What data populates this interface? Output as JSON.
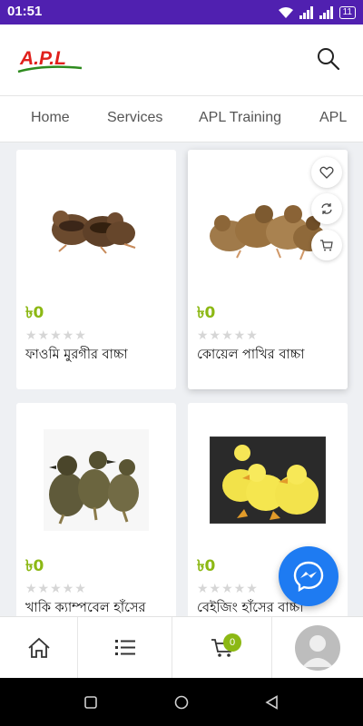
{
  "status_bar": {
    "time": "01:51",
    "battery": "11"
  },
  "header": {
    "logo_text": "A.P.L",
    "brand_color": "#e0201c",
    "accent_color": "#2e8b1e"
  },
  "nav_tabs": [
    "Home",
    "Services",
    "APL Training",
    "APL"
  ],
  "products": [
    {
      "price": "৳0",
      "rating": "★★★★★",
      "name": "ফাওমি মুরগীর বাচ্চা",
      "image": "quail-chicks"
    },
    {
      "price": "৳0",
      "rating": "★★★★★",
      "name": "কোয়েল পাখির বাচ্চা",
      "image": "quail-chicks-group"
    },
    {
      "price": "৳0",
      "rating": "★★★★★",
      "name": "খাকি ক্যাম্পবেল হাঁসের",
      "image": "ducklings-brown"
    },
    {
      "price": "৳0",
      "rating": "★★★★★",
      "name": "বেইজিং হাঁসের বাচ্চা",
      "image": "ducklings-yellow"
    }
  ],
  "card_actions": [
    "heart-icon",
    "compare-icon",
    "cart-icon"
  ],
  "bottom_nav": {
    "cart_count": "0"
  },
  "colors": {
    "status_bar": "#5020b0",
    "price": "#8cb814",
    "messenger": "#1e7bf2"
  }
}
